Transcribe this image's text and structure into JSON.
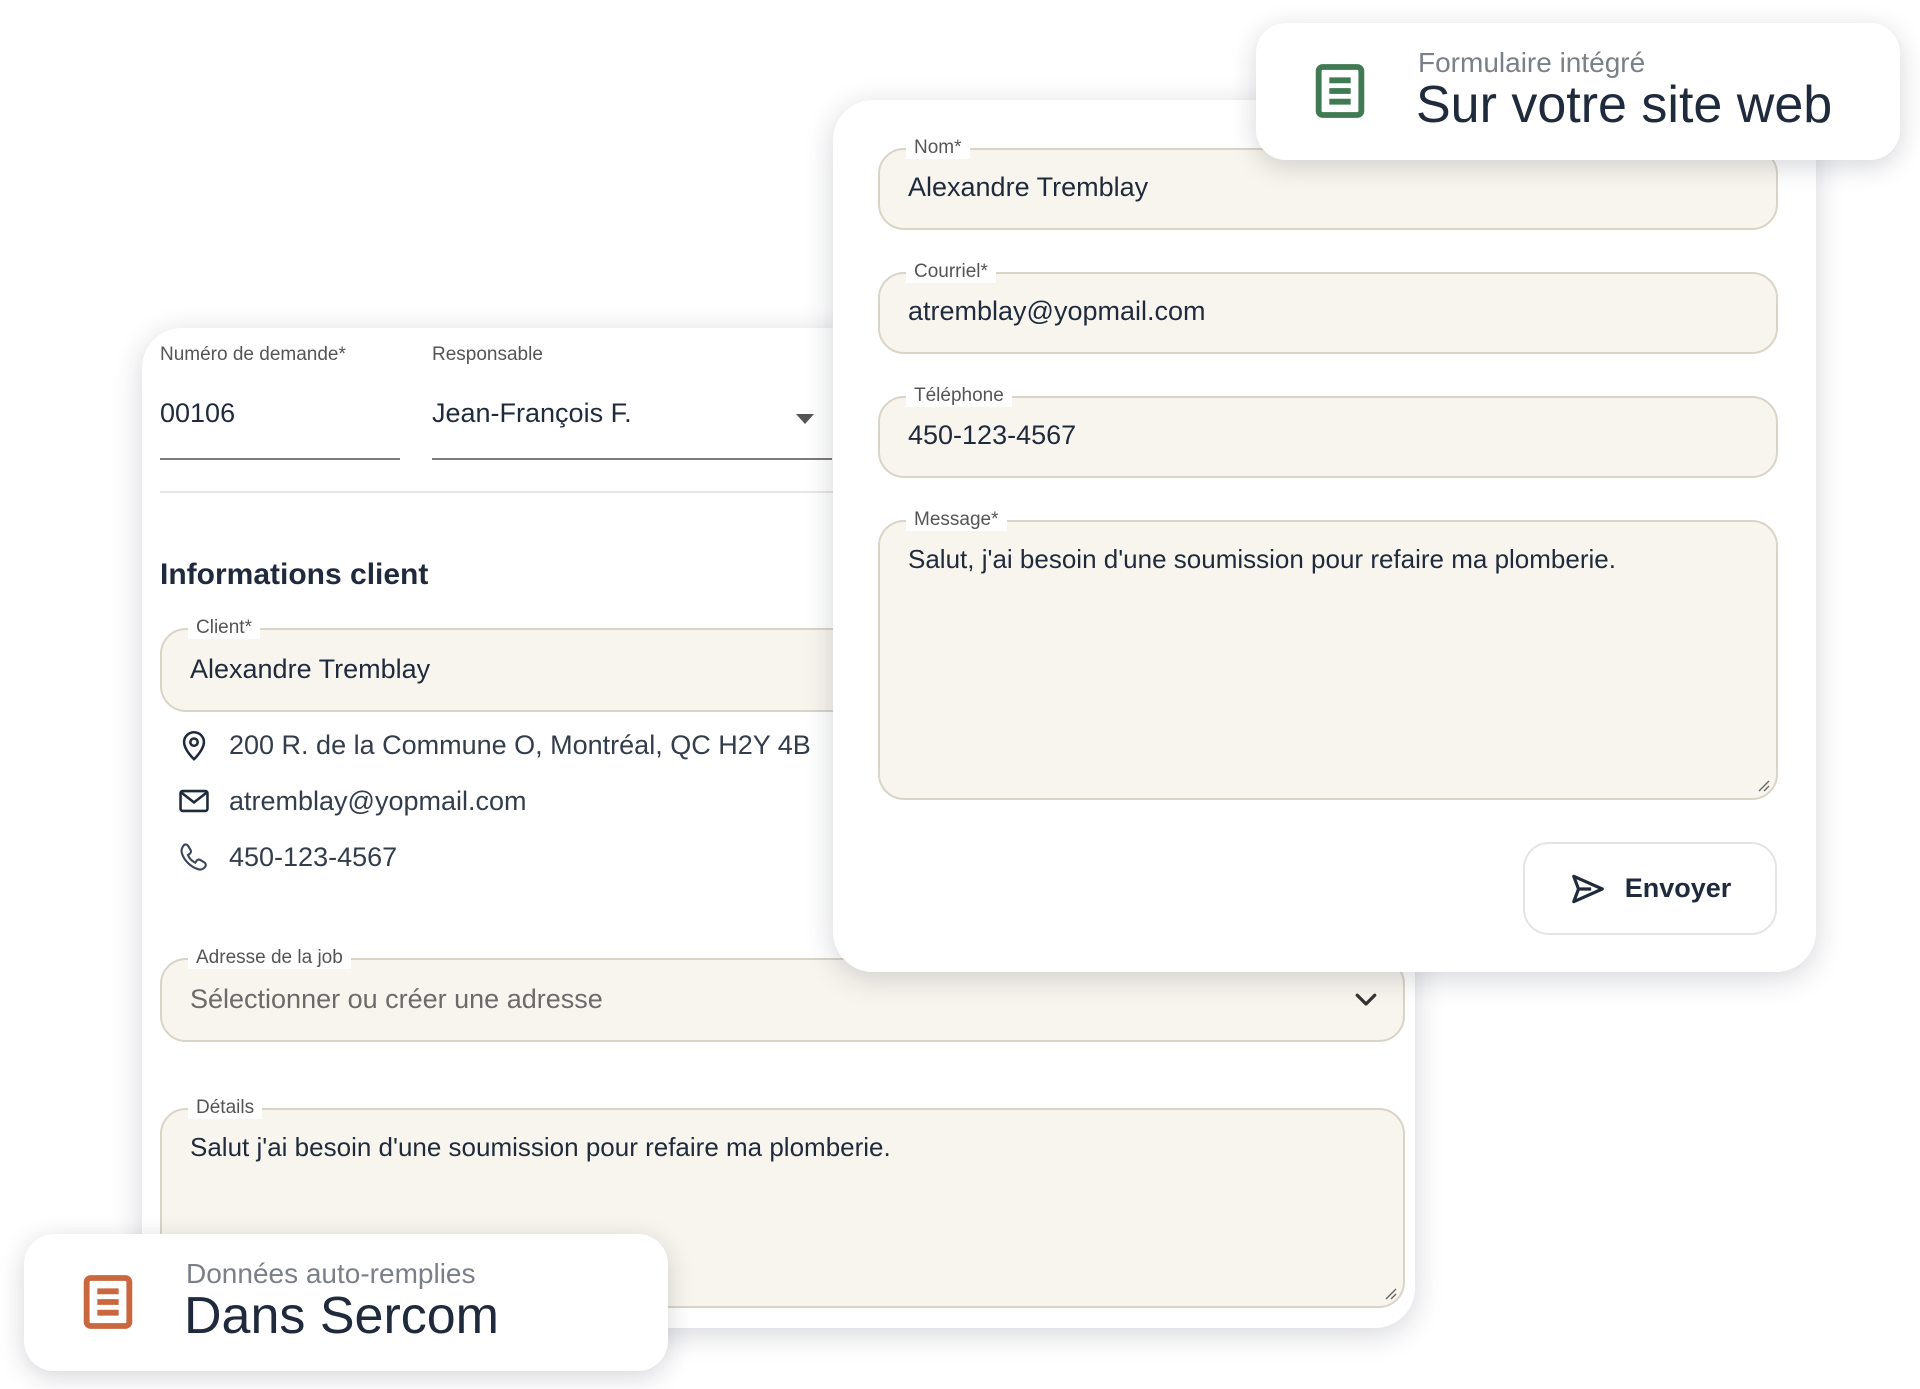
{
  "back_form": {
    "request_number": {
      "label": "Numéro de demande*",
      "value": "00106"
    },
    "responsible": {
      "label": "Responsable",
      "value": "Jean-François F."
    },
    "section_title": "Informations client",
    "client": {
      "label": "Client*",
      "value": "Alexandre Tremblay"
    },
    "address": "200 R. de la Commune O, Montréal, QC H2Y 4B",
    "email": "atremblay@yopmail.com",
    "phone": "450-123-4567",
    "job_address": {
      "label": "Adresse de la job",
      "placeholder": "Sélectionner ou créer une adresse"
    },
    "details": {
      "label": "Détails",
      "value": "Salut j'ai besoin d'une soumission pour refaire ma plomberie."
    }
  },
  "front_form": {
    "name": {
      "label": "Nom*",
      "value": "Alexandre Tremblay"
    },
    "email": {
      "label": "Courriel*",
      "value": "atremblay@yopmail.com"
    },
    "phone": {
      "label": "Téléphone",
      "value": "450-123-4567"
    },
    "message": {
      "label": "Message*",
      "value": "Salut, j'ai besoin d'une soumission pour refaire ma plomberie."
    },
    "send_label": "Envoyer"
  },
  "badges": {
    "top": {
      "subtitle": "Formulaire intégré",
      "title": "Sur votre site web",
      "icon": "document-icon",
      "color": "#3f7a52"
    },
    "bottom": {
      "subtitle": "Données auto-remplies",
      "title": "Dans Sercom",
      "icon": "document-icon",
      "color": "#c9683f"
    }
  }
}
